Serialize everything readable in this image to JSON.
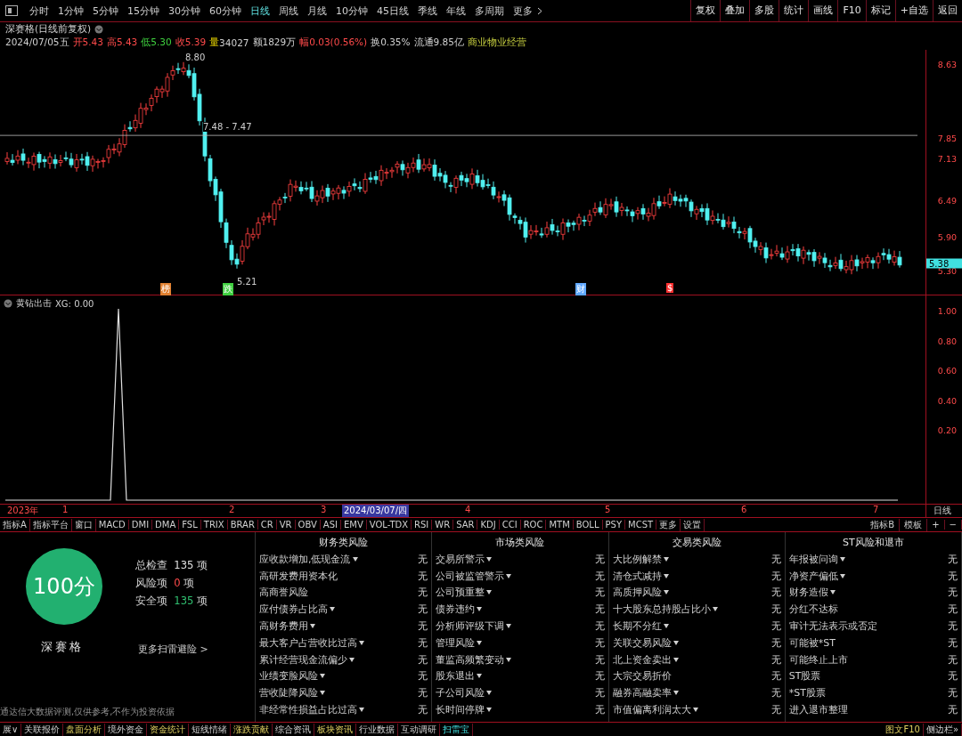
{
  "toolbar": {
    "periods": [
      {
        "label": "分时",
        "selected": false
      },
      {
        "label": "1分钟",
        "selected": false
      },
      {
        "label": "5分钟",
        "selected": false
      },
      {
        "label": "15分钟",
        "selected": false
      },
      {
        "label": "30分钟",
        "selected": false
      },
      {
        "label": "60分钟",
        "selected": false
      },
      {
        "label": "日线",
        "selected": true
      },
      {
        "label": "周线",
        "selected": false
      },
      {
        "label": "月线",
        "selected": false
      },
      {
        "label": "10分钟",
        "selected": false
      },
      {
        "label": "45日线",
        "selected": false
      },
      {
        "label": "季线",
        "selected": false
      },
      {
        "label": "年线",
        "selected": false
      },
      {
        "label": "多周期",
        "selected": false
      },
      {
        "label": "更多",
        "selected": false
      }
    ],
    "actions": [
      "复权",
      "叠加",
      "多股",
      "统计",
      "画线",
      "F10",
      "标记",
      "+自选",
      "返回"
    ]
  },
  "stock": {
    "title": "深赛格(日线前复权)",
    "date": "2024/07/05五",
    "quotes": [
      {
        "text": "开5.43",
        "kind": "up"
      },
      {
        "text": "高5.43",
        "kind": "up"
      },
      {
        "text": "低5.30",
        "kind": "down"
      },
      {
        "text": "收5.39",
        "kind": "up"
      },
      {
        "text": "量",
        "kind": "volume"
      },
      {
        "text": "34027",
        "kind": "plain"
      },
      {
        "text": "额1829万",
        "kind": "plain"
      },
      {
        "text": "幅0.03(0.56%)",
        "kind": "up"
      },
      {
        "text": "换0.35%",
        "kind": "plain"
      },
      {
        "text": "流通9.85亿",
        "kind": "plain"
      },
      {
        "text": "商业物业经营",
        "kind": "industry"
      }
    ]
  },
  "price_chart": {
    "axis": [
      "8.63",
      "7.85",
      "7.13",
      "6.49",
      "5.90",
      "5.30"
    ],
    "last_price": "5.38",
    "high_label": "8.80",
    "low_label": "5.21",
    "line_label": "7.48 - 7.47",
    "events": [
      {
        "text": "榜",
        "color": "#e08030"
      },
      {
        "text": "跌",
        "color": "#40d040"
      },
      {
        "text": "财",
        "color": "#60a8ff"
      },
      {
        "text": "$",
        "color": "#ff3030"
      }
    ]
  },
  "indicator": {
    "name": "黄钻出击",
    "reading": "XG: 0.00",
    "axis": [
      "1.00",
      "0.80",
      "0.60",
      "0.40",
      "0.20"
    ]
  },
  "date_axis": {
    "labels": [
      {
        "text": "2023年",
        "selected": false
      },
      {
        "text": "1",
        "selected": false
      },
      {
        "text": "2",
        "selected": false
      },
      {
        "text": "3",
        "selected": false
      },
      {
        "text": "2024/03/07/四",
        "selected": true
      },
      {
        "text": "4",
        "selected": false
      },
      {
        "text": "5",
        "selected": false
      },
      {
        "text": "6",
        "selected": false
      },
      {
        "text": "7",
        "selected": false
      }
    ],
    "period": "日线"
  },
  "indicator_tabs": {
    "items": [
      "指标A",
      "指标平台",
      "窗口",
      "MACD",
      "DMI",
      "DMA",
      "FSL",
      "TRIX",
      "BRAR",
      "CR",
      "VR",
      "OBV",
      "ASI",
      "EMV",
      "VOL-TDX",
      "RSI",
      "WR",
      "SAR",
      "KDJ",
      "CCI",
      "ROC",
      "MTM",
      "BOLL",
      "PSY",
      "MCST",
      "更多",
      "设置"
    ],
    "right": [
      "指标B",
      "模板",
      "+",
      "−"
    ]
  },
  "risk": {
    "score": "100分",
    "name": "深赛格",
    "stats": [
      {
        "label": "总检查",
        "value": "135",
        "unit": "项",
        "kind": "total"
      },
      {
        "label": "风险项",
        "value": "0",
        "unit": "项",
        "kind": "risk"
      },
      {
        "label": "安全项",
        "value": "135",
        "unit": "项",
        "kind": "safe"
      }
    ],
    "more": "更多扫雷避险 >",
    "disclaimer": "通达信大数据评测,仅供参考,不作为投资依据",
    "columns": [
      {
        "title": "财务类风险",
        "items": [
          {
            "label": "应收款增加,低现金流",
            "dropdown": true,
            "value": "无"
          },
          {
            "label": "高研发费用资本化",
            "dropdown": false,
            "value": "无"
          },
          {
            "label": "高商誉风险",
            "dropdown": false,
            "value": "无"
          },
          {
            "label": "应付债券占比高",
            "dropdown": true,
            "value": "无"
          },
          {
            "label": "高财务费用",
            "dropdown": true,
            "value": "无"
          },
          {
            "label": "最大客户占营收比过高",
            "dropdown": true,
            "value": "无"
          },
          {
            "label": "累计经营现金流偏少",
            "dropdown": true,
            "value": "无"
          },
          {
            "label": "业绩变脸风险",
            "dropdown": true,
            "value": "无"
          },
          {
            "label": "营收陡降风险",
            "dropdown": true,
            "value": "无"
          },
          {
            "label": "非经常性损益占比过高",
            "dropdown": true,
            "value": "无"
          }
        ]
      },
      {
        "title": "市场类风险",
        "items": [
          {
            "label": "交易所警示",
            "dropdown": true,
            "value": "无"
          },
          {
            "label": "公司被监管警示",
            "dropdown": true,
            "value": "无"
          },
          {
            "label": "公司预重整",
            "dropdown": true,
            "value": "无"
          },
          {
            "label": "债券违约",
            "dropdown": true,
            "value": "无"
          },
          {
            "label": "分析师评级下调",
            "dropdown": true,
            "value": "无"
          },
          {
            "label": "管理风险",
            "dropdown": true,
            "value": "无"
          },
          {
            "label": "董监高频繁变动",
            "dropdown": true,
            "value": "无"
          },
          {
            "label": "股东退出",
            "dropdown": true,
            "value": "无"
          },
          {
            "label": "子公司风险",
            "dropdown": true,
            "value": "无"
          },
          {
            "label": "长时间停牌",
            "dropdown": true,
            "value": "无"
          }
        ]
      },
      {
        "title": "交易类风险",
        "items": [
          {
            "label": "大比例解禁",
            "dropdown": true,
            "value": "无"
          },
          {
            "label": "清仓式减持",
            "dropdown": true,
            "value": "无"
          },
          {
            "label": "高质押风险",
            "dropdown": true,
            "value": "无"
          },
          {
            "label": "十大股东总持股占比小",
            "dropdown": true,
            "value": "无"
          },
          {
            "label": "长期不分红",
            "dropdown": true,
            "value": "无"
          },
          {
            "label": "关联交易风险",
            "dropdown": true,
            "value": "无"
          },
          {
            "label": "北上资金卖出",
            "dropdown": true,
            "value": "无"
          },
          {
            "label": "大宗交易折价",
            "dropdown": false,
            "value": "无"
          },
          {
            "label": "融券高融卖率",
            "dropdown": true,
            "value": "无"
          },
          {
            "label": "市值偏离利润太大",
            "dropdown": true,
            "value": "无"
          }
        ]
      },
      {
        "title": "ST风险和退市",
        "items": [
          {
            "label": "年报被问询",
            "dropdown": true,
            "value": "无"
          },
          {
            "label": "净资产偏低",
            "dropdown": true,
            "value": "无"
          },
          {
            "label": "财务造假",
            "dropdown": true,
            "value": "无"
          },
          {
            "label": "分红不达标",
            "dropdown": false,
            "value": "无"
          },
          {
            "label": "审计无法表示或否定",
            "dropdown": false,
            "value": "无"
          },
          {
            "label": "可能被*ST",
            "dropdown": false,
            "value": "无"
          },
          {
            "label": "可能终止上市",
            "dropdown": false,
            "value": "无"
          },
          {
            "label": "ST股票",
            "dropdown": false,
            "value": "无"
          },
          {
            "label": "*ST股票",
            "dropdown": false,
            "value": "无"
          },
          {
            "label": "进入退市整理",
            "dropdown": false,
            "value": "无"
          }
        ]
      }
    ]
  },
  "bottom_tabs": {
    "items": [
      {
        "label": "展∨",
        "selected": false
      },
      {
        "label": "关联报价",
        "selected": false
      },
      {
        "label": "盘面分析",
        "selected": false
      },
      {
        "label": "境外资金",
        "selected": false
      },
      {
        "label": "资金统计",
        "selected": false
      },
      {
        "label": "短线情绪",
        "selected": false
      },
      {
        "label": "涨跌贡献",
        "selected": false
      },
      {
        "label": "综合资讯",
        "selected": false
      },
      {
        "label": "板块资讯",
        "selected": false
      },
      {
        "label": "行业数据",
        "selected": false
      },
      {
        "label": "互动调研",
        "selected": false
      },
      {
        "label": "扫雷宝",
        "selected": true
      }
    ],
    "right": [
      "图文F10",
      "侧边栏»"
    ]
  }
}
